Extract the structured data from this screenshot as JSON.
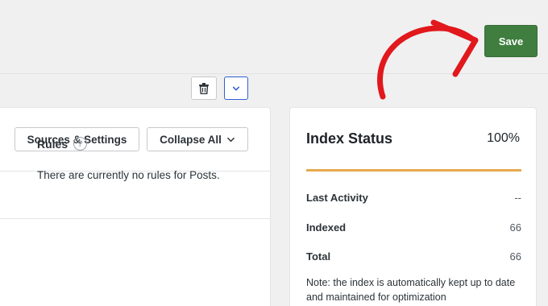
{
  "header": {
    "save_label": "Save"
  },
  "source_panel": {
    "sources_button": "Sources & Settings",
    "collapse_button": "Collapse All",
    "rules_title": "Rules",
    "help_glyph": "?",
    "rules_empty": "There are currently no rules for Posts."
  },
  "index_status": {
    "title": "Index Status",
    "percent_text": "100%",
    "progress": 1.0,
    "progress_color": "#e8a94d",
    "stats": [
      {
        "label": "Last Activity",
        "value": "--"
      },
      {
        "label": "Indexed",
        "value": "66"
      },
      {
        "label": "Total",
        "value": "66"
      }
    ],
    "note": "Note: the index is automatically kept up to date and maintained for optimization"
  },
  "colors": {
    "save_green": "#3f7e3f",
    "arrow_red": "#e1181c",
    "expand_blue": "#2f5fd0"
  },
  "icons": [
    "arrow-icon",
    "trash-icon",
    "chevron-down-icon",
    "help-icon"
  ]
}
